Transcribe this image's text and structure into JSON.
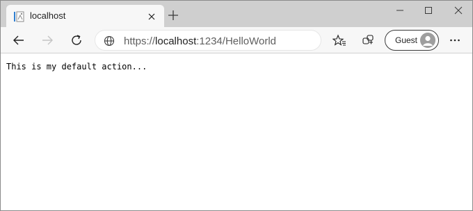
{
  "tab": {
    "title": "localhost"
  },
  "window_controls": {
    "minimize": "minimize",
    "maximize": "maximize",
    "close": "close"
  },
  "toolbar": {
    "url_host_prefix": "https://",
    "url_host": "localhost",
    "url_path": ":1234/HelloWorld",
    "profile_label": "Guest"
  },
  "page": {
    "body_text": "This is my default action..."
  },
  "icons": {
    "favicon": "document-icon",
    "back": "arrow-left-icon",
    "forward": "arrow-right-icon",
    "refresh": "refresh-icon",
    "site_info": "globe-icon",
    "favorites": "star-list-icon",
    "collections": "collections-icon",
    "more": "ellipsis-icon"
  },
  "colors": {
    "tabstrip": "#cfcfcf",
    "toolbar": "#f7f7f7",
    "favicon_accent": "#2f7fd1"
  }
}
